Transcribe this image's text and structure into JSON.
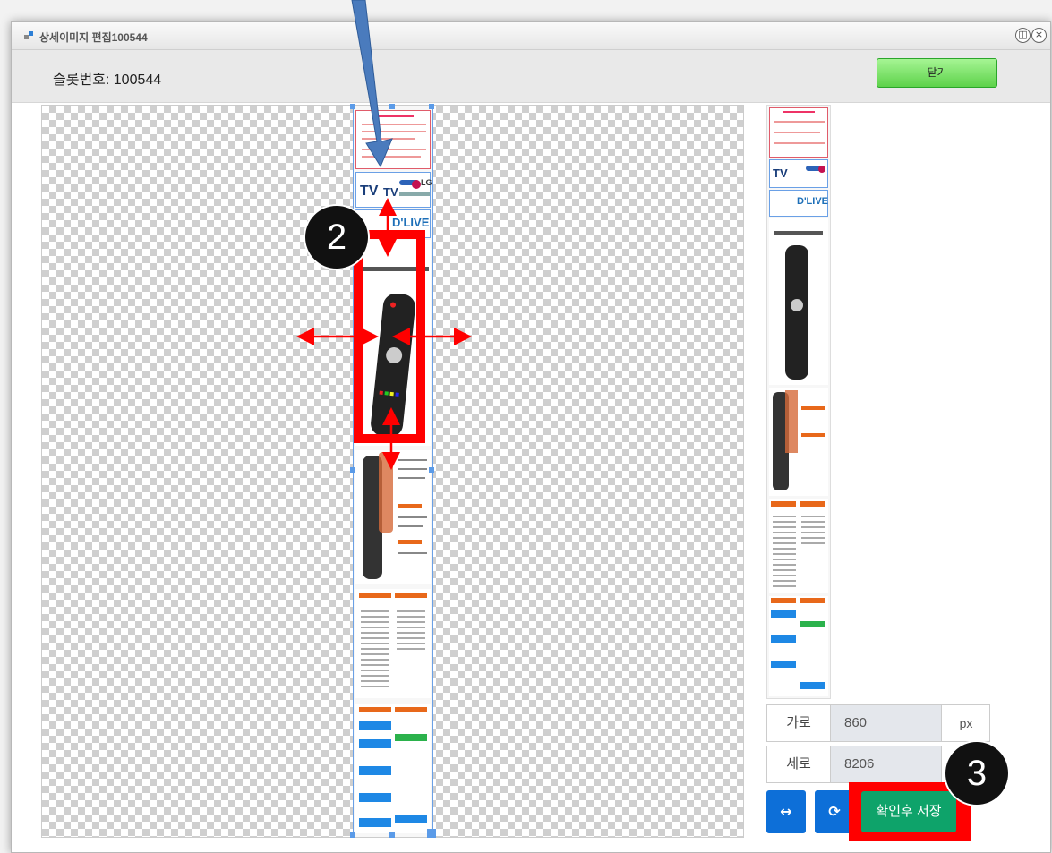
{
  "window": {
    "title": "상세이미지 편집100544",
    "controls": {
      "restore": "◫",
      "close": "×"
    }
  },
  "header": {
    "slot_label": "슬롯번호: 100544",
    "close_button": "닫기"
  },
  "image_preview": {
    "banner_text_1": "TV",
    "banner_text_2": "LG",
    "banner_text_3": "D'LIVE"
  },
  "thumbnail": {
    "tv_label": "TV",
    "dlive_label": "D'LIVE"
  },
  "size_fields": {
    "width_label": "가로",
    "width_value": "860",
    "width_unit": "px",
    "height_label": "세로",
    "height_value": "8206"
  },
  "actions": {
    "flip_icon": "↔",
    "refresh_icon": "⟳",
    "save_label": "확인후 저장"
  },
  "annotations": {
    "step2": "2",
    "step3": "3"
  },
  "colors": {
    "accent_green": "#0ea36a",
    "accent_blue": "#0d6fd8",
    "annotation_red": "#ff0000",
    "arrow_blue": "#4a7bbd"
  }
}
